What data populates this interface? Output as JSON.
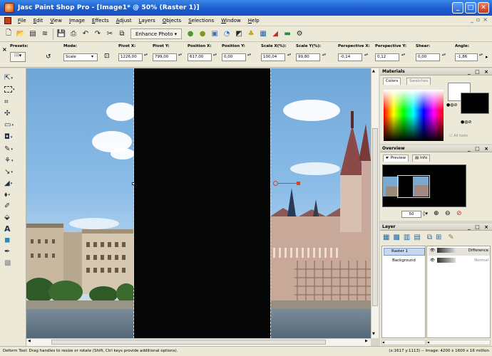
{
  "window": {
    "title": "Jasc Paint Shop Pro - [Image1* @  50% (Raster 1)]",
    "minimize": "_",
    "maximize": "□",
    "close": "✕"
  },
  "menu": {
    "items": [
      "File",
      "Edit",
      "View",
      "Image",
      "Effects",
      "Adjust",
      "Layers",
      "Objects",
      "Selections",
      "Window",
      "Help"
    ]
  },
  "toolbar": {
    "enhance_label": "Enhance Photo ▾"
  },
  "options": {
    "presets_label": "Presets:",
    "mode_label": "Mode:",
    "mode_value": "Scale",
    "pivot_x_label": "Pivot X:",
    "pivot_x_value": "1226,00",
    "pivot_y_label": "Pivot Y:",
    "pivot_y_value": "799,00",
    "position_x_label": "Position X:",
    "position_x_value": "617,00",
    "position_y_label": "Position Y:",
    "position_y_value": "0,00",
    "scale_x_label": "Scale X(%):",
    "scale_x_value": "100,04",
    "scale_y_label": "Scale Y(%):",
    "scale_y_value": "99,80",
    "perspective_x_label": "Perspective X:",
    "perspective_x_value": "-0,14",
    "perspective_y_label": "Perspective Y:",
    "perspective_y_value": "0,12",
    "shear_label": "Shear:",
    "shear_value": "0,00",
    "angle_label": "Angle:",
    "angle_value": "-1,86"
  },
  "materials": {
    "title": "Materials",
    "tab_colors": "Colors",
    "tab_swatches": "Swatches",
    "all_tools": "All tools"
  },
  "overview": {
    "title": "Overview",
    "tab_preview": "Preview",
    "tab_info": "Info",
    "zoom_value": "50"
  },
  "layers": {
    "title": "Layer",
    "rows": [
      {
        "name": "Raster 1",
        "blend": "Difference"
      },
      {
        "name": "Background",
        "blend": "Normal"
      }
    ]
  },
  "status": {
    "left": "Deform Tool: Drag handles to resize or rotate (Shift, Ctrl keys provide additional options).",
    "right": "(x:1617 y:1113) -- Image:  4200 x 1600 x 16 million"
  },
  "colors": {
    "titlebar": "#1c5ccf",
    "canvas_black": "#060606",
    "sky": "#8cbde8",
    "handle": "#e04020"
  }
}
